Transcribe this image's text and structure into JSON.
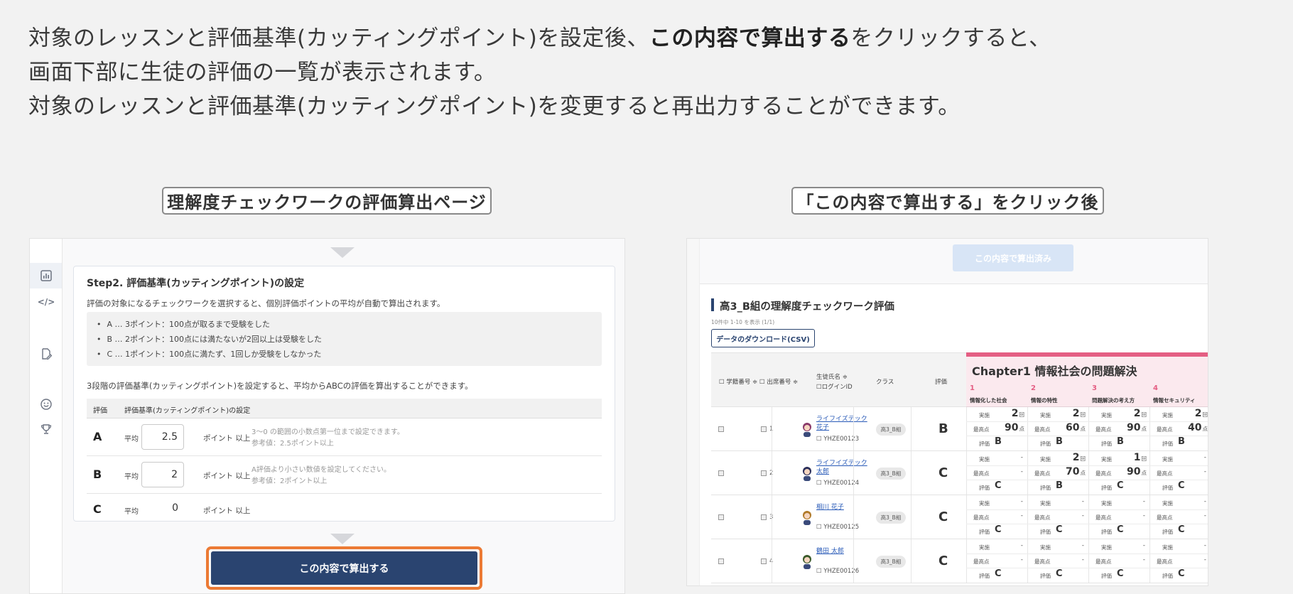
{
  "intro": {
    "line1_pre": "対象のレッスンと評価基準(カッティングポイント)を設定後、",
    "line1_bold": "この内容で算出する",
    "line1_post": "をクリックすると、",
    "line2": "画面下部に生徒の評価の一覧が表示されます。",
    "line3": "対象のレッスンと評価基準(カッティングポイント)を変更すると再出力することができます。"
  },
  "captions": {
    "left": "理解度チェックワークの評価算出ページ",
    "right": "「この内容で算出する」をクリック後"
  },
  "sidebar": {
    "icons": [
      "chart-icon",
      "code-icon",
      "document-edit-icon",
      "smile-icon",
      "trophy-icon"
    ]
  },
  "step2": {
    "title": "Step2. 評価基準(カッティングポイント)の設定",
    "desc": "評価の対象になるチェックワークを選択すると、個別評価ポイントの平均が自動で算出されます。",
    "criteria": [
      "A … 3ポイント：100点が取るまで受験をした",
      "B … 2ポイント：100点には満たないが2回以上は受験をした",
      "C … 1ポイント：100点に満たず、1回しか受験をしなかった"
    ],
    "desc2": "3段階の評価基準(カッティングポイント)を設定すると、平均からABCの評価を算出することができます。",
    "table_headers": {
      "grade": "評価",
      "criteria": "評価基準(カッティングポイント)の設定"
    },
    "rows": [
      {
        "grade": "A",
        "avg_label": "平均",
        "value": "2.5",
        "unit": "ポイント 以上",
        "note1": "3〜0 の範囲の小数点第一位まで設定できます。",
        "note2": "参考値：2.5ポイント以上"
      },
      {
        "grade": "B",
        "avg_label": "平均",
        "value": "2",
        "unit": "ポイント 以上",
        "note1": "A評価より小さい数値を設定してください。",
        "note2": "参考値：2ポイント以上"
      },
      {
        "grade": "C",
        "avg_label": "平均",
        "value": "0",
        "unit": "ポイント 以上",
        "note1": "",
        "note2": ""
      }
    ],
    "calc_button": "この内容で算出する"
  },
  "result": {
    "done_button": "この内容で算出済み",
    "title": "高3_B組の理解度チェックワーク評価",
    "count": "10件中 1-10 を表示 (1/1)",
    "csv_button": "データのダウンロード(CSV)",
    "headers": {
      "student_no": "学籍番号 ≑",
      "seat_no": "出席番号 ≑",
      "name": "生徒氏名 ≑",
      "login": "ログインID",
      "class": "クラス",
      "grade": "評価"
    },
    "chapter": {
      "title": "Chapter1  情報社会の問題解決",
      "sections": [
        {
          "num": "1",
          "label": "情報化した社会"
        },
        {
          "num": "2",
          "label": "情報の特性"
        },
        {
          "num": "3",
          "label": "問題解決の考え方"
        },
        {
          "num": "4",
          "label": "情報セキュリティ"
        }
      ]
    },
    "labels": {
      "attempts": "実施",
      "best": "最高点",
      "eval": "評価",
      "times_unit": "回",
      "points_unit": "点",
      "dash": "-"
    },
    "students": [
      {
        "seat": "1",
        "name": "ライフイズテック 花子",
        "id": "YHZE00123",
        "class": "高3_B組",
        "grade": "B",
        "cells": [
          {
            "att": "2",
            "best": "90",
            "eval": "B"
          },
          {
            "att": "2",
            "best": "60",
            "eval": "B"
          },
          {
            "att": "2",
            "best": "90",
            "eval": "B"
          },
          {
            "att": "2",
            "best": "40",
            "eval": "B"
          }
        ]
      },
      {
        "seat": "2",
        "name": "ライフイズテック 太郎",
        "id": "YHZE00124",
        "class": "高3_B組",
        "grade": "C",
        "cells": [
          {
            "att": "",
            "best": "",
            "eval": "C"
          },
          {
            "att": "2",
            "best": "70",
            "eval": "B"
          },
          {
            "att": "1",
            "best": "90",
            "eval": "C"
          },
          {
            "att": "",
            "best": "",
            "eval": "C"
          }
        ]
      },
      {
        "seat": "3",
        "name": "相川 花子",
        "id": "YHZE00125",
        "class": "高3_B組",
        "grade": "C",
        "cells": [
          {
            "att": "",
            "best": "",
            "eval": "C"
          },
          {
            "att": "",
            "best": "",
            "eval": "C"
          },
          {
            "att": "",
            "best": "",
            "eval": "C"
          },
          {
            "att": "",
            "best": "",
            "eval": "C"
          }
        ]
      },
      {
        "seat": "4",
        "name": "鶴田 太郎",
        "id": "YHZE00126",
        "class": "高3_B組",
        "grade": "C",
        "cells": [
          {
            "att": "",
            "best": "",
            "eval": "C"
          },
          {
            "att": "",
            "best": "",
            "eval": "C"
          },
          {
            "att": "",
            "best": "",
            "eval": "C"
          },
          {
            "att": "",
            "best": "",
            "eval": "C"
          }
        ]
      }
    ]
  }
}
